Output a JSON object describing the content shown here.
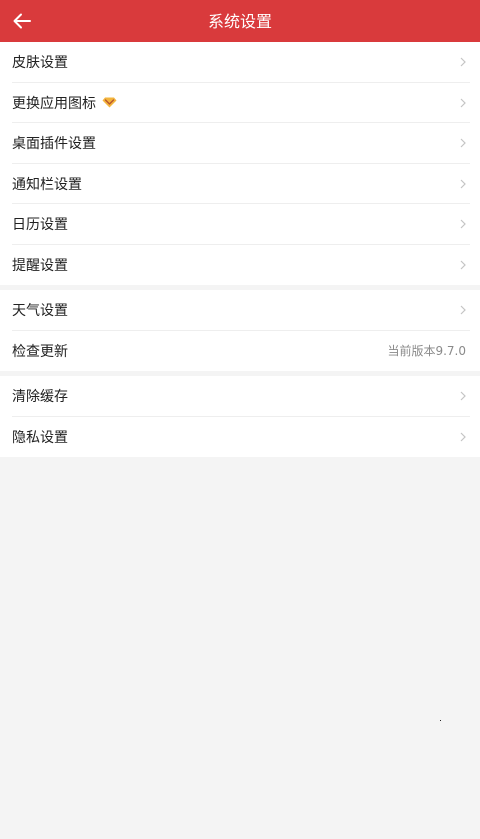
{
  "header": {
    "title": "系统设置",
    "back_icon": "arrow-left-icon",
    "background_color": "#d93a3c"
  },
  "groups": [
    {
      "items": [
        {
          "label": "皮肤设置",
          "has_chevron": true
        },
        {
          "label": "更换应用图标",
          "badge_icon": "vip-diamond-icon",
          "has_chevron": true
        },
        {
          "label": "桌面插件设置",
          "has_chevron": true
        },
        {
          "label": "通知栏设置",
          "has_chevron": true
        },
        {
          "label": "日历设置",
          "has_chevron": true
        },
        {
          "label": "提醒设置",
          "has_chevron": true
        }
      ]
    },
    {
      "items": [
        {
          "label": "天气设置",
          "has_chevron": true
        },
        {
          "label": "检查更新",
          "value": "当前版本9.7.0",
          "has_chevron": false
        }
      ]
    },
    {
      "items": [
        {
          "label": "清除缓存",
          "has_chevron": true
        },
        {
          "label": "隐私设置",
          "has_chevron": true
        }
      ]
    }
  ]
}
